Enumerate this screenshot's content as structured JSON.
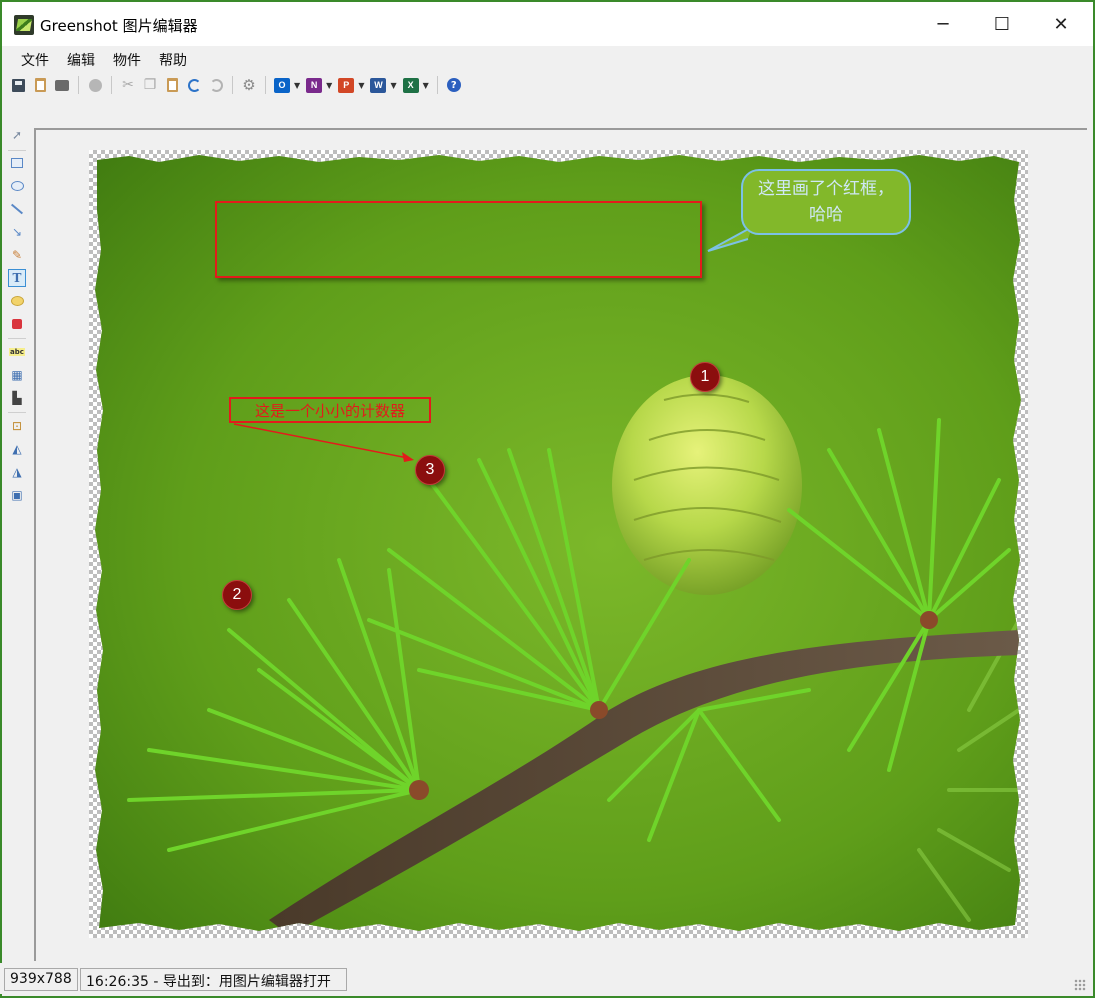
{
  "window": {
    "title": "Greenshot 图片编辑器"
  },
  "window_controls": {
    "minimize": "─",
    "maximize": "☐",
    "close": "✕"
  },
  "menu": [
    "文件",
    "编辑",
    "物件",
    "帮助"
  ],
  "toolbar": {
    "icons": [
      "save-icon",
      "clipboard-icon",
      "print-icon",
      "delete-icon",
      "cut-icon",
      "copy-icon",
      "paste-icon",
      "undo-icon",
      "redo-icon",
      "settings-icon",
      "outlook-icon",
      "onenote-icon",
      "powerpoint-icon",
      "word-icon",
      "excel-icon",
      "help-icon"
    ],
    "app_letters": {
      "outlook": "O",
      "onenote": "N",
      "powerpoint": "P",
      "word": "W",
      "excel": "X"
    },
    "app_colors": {
      "outlook": "#0a64c8",
      "onenote": "#7a2a8c",
      "powerpoint": "#d24726",
      "word": "#2b579a",
      "excel": "#1e7145"
    },
    "help": "?"
  },
  "tools": [
    "cursor-tool",
    "rectangle-tool",
    "ellipse-tool",
    "line-tool",
    "arrow-tool",
    "freehand-tool",
    "text-tool",
    "speech-bubble-tool",
    "counter-tool",
    "highlight-tool",
    "obfuscate-tool",
    "crop-tool-group",
    "crop-tool",
    "rotate-cw-tool",
    "rotate-ccw-tool",
    "resize-tool"
  ],
  "active_tool": "text-tool",
  "canvas": {
    "speech_bubble_text": "这里画了个红框，哈哈",
    "textbox_text": "这是一个小小的计数器",
    "counters": [
      "1",
      "2",
      "3"
    ],
    "annotation_color": "#e31b1b",
    "counter_color": "#8b0e0e",
    "bubble_border_color": "#7cc1e6"
  },
  "status": {
    "dimensions": "939x788",
    "message": "16:26:35 - 导出到：用图片编辑器打开"
  }
}
